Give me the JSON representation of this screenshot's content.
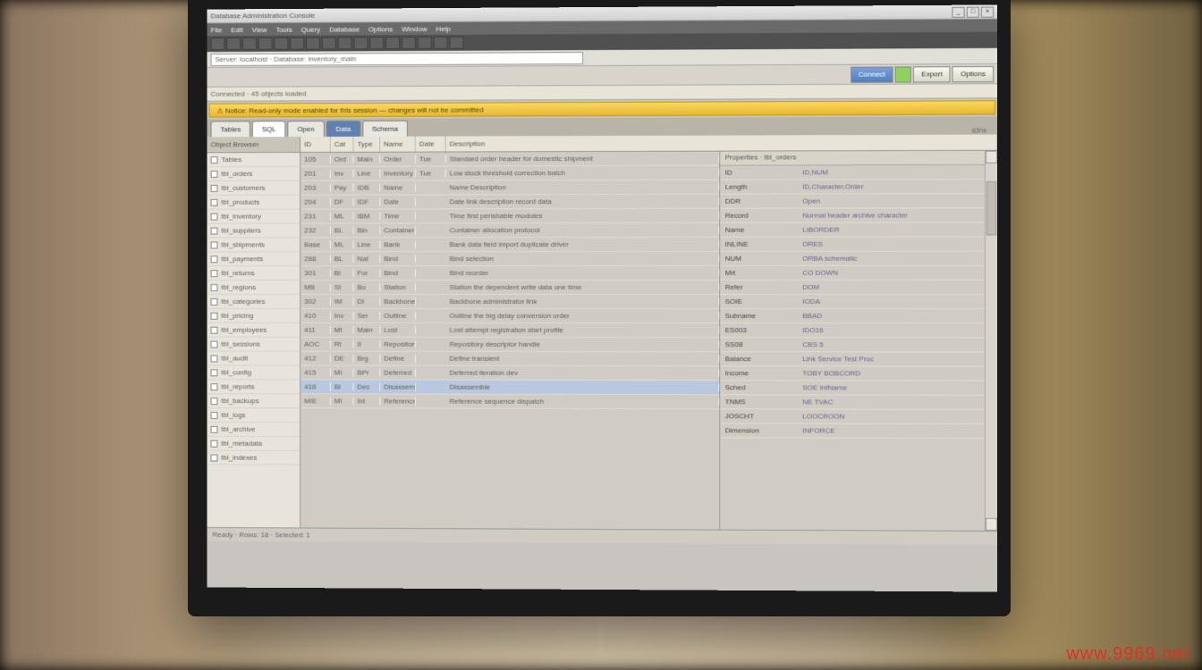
{
  "window": {
    "title": "Database Administration Console",
    "watermark": "www.9969.net"
  },
  "menubar": [
    "File",
    "Edit",
    "View",
    "Tools",
    "Query",
    "Database",
    "Options",
    "Window",
    "Help"
  ],
  "toolbar2": {
    "address": "Server: localhost · Database: inventory_main"
  },
  "rtoolbar": {
    "btn_connect": "Connect",
    "btn_export": "Export",
    "btn_options": "Options"
  },
  "subbar": {
    "text": "Connected · 45 objects loaded"
  },
  "yellowbar": {
    "msg": "Notice: Read-only mode enabled for this session — changes will not be committed"
  },
  "tabs": [
    {
      "label": "Tables",
      "active": false
    },
    {
      "label": "SQL",
      "active": true,
      "blue": false
    },
    {
      "label": "Open",
      "active": false
    },
    {
      "label": "Data",
      "active": false,
      "blue": true
    },
    {
      "label": "Schema",
      "active": false
    }
  ],
  "sidebar": {
    "header": "Object Browser",
    "items": [
      "Tables",
      "tbl_orders",
      "tbl_customers",
      "tbl_products",
      "tbl_inventory",
      "tbl_suppliers",
      "tbl_shipments",
      "tbl_payments",
      "tbl_returns",
      "tbl_regions",
      "tbl_categories",
      "tbl_pricing",
      "tbl_employees",
      "tbl_sessions",
      "tbl_audit",
      "tbl_config",
      "tbl_reports",
      "tbl_backups",
      "tbl_logs",
      "tbl_archive",
      "tbl_metadata",
      "tbl_indexes"
    ]
  },
  "columns": {
    "left": [
      "ID",
      "Cat",
      "Type",
      "Name",
      "Date",
      "Description"
    ],
    "right_header": "Properties · tbl_orders",
    "percent": "65%"
  },
  "rows": [
    {
      "id": "105",
      "cat": "Ord",
      "type": "Main",
      "name": "Order header record",
      "date": "Tue",
      "desc": "Standard order header for domestic shipment"
    },
    {
      "id": "201",
      "cat": "Inv",
      "type": "Line",
      "name": "Inventory adjustment",
      "date": "Tue",
      "desc": "Low stock threshold correction batch"
    },
    {
      "id": "203",
      "cat": "Pay",
      "type": "IDB",
      "name": "Name Description",
      "date": "",
      "desc": ""
    },
    {
      "id": "204",
      "cat": "DF",
      "type": "IDF",
      "name": "Date link description record data",
      "date": "",
      "desc": ""
    },
    {
      "id": "231",
      "cat": "ML",
      "type": "IBM",
      "name": "Time first perishable modules",
      "date": "",
      "desc": ""
    },
    {
      "id": "232",
      "cat": "BL",
      "type": "Bin",
      "name": "Container allocation protocol",
      "date": "",
      "desc": ""
    },
    {
      "id": "Base",
      "cat": "ML",
      "type": "Line",
      "name": "Bank data field import duplicate driver",
      "date": "",
      "desc": ""
    },
    {
      "id": "288",
      "cat": "BL",
      "type": "Nat",
      "name": "Bind selection",
      "date": "",
      "desc": ""
    },
    {
      "id": "301",
      "cat": "Bl",
      "type": "For",
      "name": "Bind reorder",
      "date": "",
      "desc": ""
    },
    {
      "id": "MB",
      "cat": "St",
      "type": "Bo",
      "name": "Station the dependent write data one time",
      "date": "",
      "desc": ""
    },
    {
      "id": "302",
      "cat": "IM",
      "type": "DI",
      "name": "Backbone administrator link",
      "date": "",
      "desc": ""
    },
    {
      "id": "410",
      "cat": "Inv",
      "type": "Ser",
      "name": "Outline the big delay conversion order",
      "date": "",
      "desc": ""
    },
    {
      "id": "411",
      "cat": "Mt",
      "type": "Main",
      "name": "Lost attempt registration start profile",
      "date": "",
      "desc": ""
    },
    {
      "id": "AOC",
      "cat": "Rt",
      "type": "II",
      "name": "Repository descriptor handle",
      "date": "",
      "desc": ""
    },
    {
      "id": "412",
      "cat": "DE",
      "type": "Brg",
      "name": "Define transient",
      "date": "",
      "desc": ""
    },
    {
      "id": "415",
      "cat": "MI",
      "type": "BPr",
      "name": "Deferred iteration dev",
      "date": "",
      "desc": ""
    },
    {
      "id": "416",
      "cat": "Bl",
      "type": "Dec",
      "name": "Disassemble",
      "date": "",
      "desc": ""
    },
    {
      "id": "MIE",
      "cat": "MI",
      "type": "Int",
      "name": "Reference sequence dispatch",
      "date": "",
      "desc": ""
    }
  ],
  "properties": [
    {
      "k": "ID",
      "v": "ID,NUM"
    },
    {
      "k": "Length",
      "v": "ID,Character,Order"
    },
    {
      "k": "DDR",
      "v": "Open"
    },
    {
      "k": "Record",
      "v": "Normal header archive character"
    },
    {
      "k": "Name",
      "v": "LIBORDER"
    },
    {
      "k": "INLINE",
      "v": "ORES"
    },
    {
      "k": "NUM",
      "v": "ORBA schematic"
    },
    {
      "k": "Mrt",
      "v": "CO DOWN"
    },
    {
      "k": "Refer",
      "v": "DOM"
    },
    {
      "k": "SOIE",
      "v": "IODA"
    },
    {
      "k": "Subname",
      "v": "BBAD"
    },
    {
      "k": "ES003",
      "v": "IDO16"
    },
    {
      "k": "SS08",
      "v": "CBS 5"
    },
    {
      "k": "Balance",
      "v": "Link Service Test Proc"
    },
    {
      "k": "Income",
      "v": "TOBY BOBCORD"
    },
    {
      "k": "Sched",
      "v": "SOE IntName"
    },
    {
      "k": "TNMS",
      "v": "NE TVAC"
    },
    {
      "k": "JOSCHT",
      "v": "LOOCROON"
    },
    {
      "k": "Dimension",
      "v": "INFORCE"
    }
  ],
  "statusbar": {
    "text": "Ready · Rows: 18 · Selected: 1"
  }
}
